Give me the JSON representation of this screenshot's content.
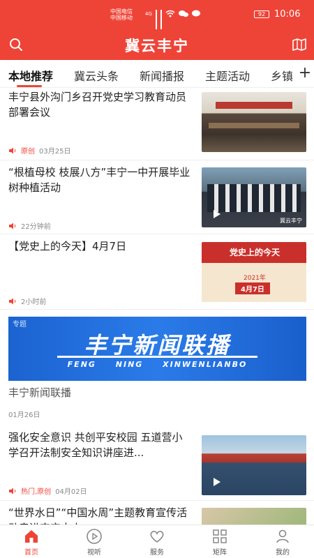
{
  "status_bar": {
    "carrier_1": "中国电信",
    "carrier_2": "中国移动",
    "network": "4G",
    "battery": "92",
    "time": "10:06"
  },
  "header": {
    "title": "冀云丰宁",
    "search_icon": "search-icon",
    "map_icon": "map-icon"
  },
  "tabs": [
    {
      "label": "本地推荐",
      "active": true
    },
    {
      "label": "冀云头条"
    },
    {
      "label": "新闻播报"
    },
    {
      "label": "主题活动"
    },
    {
      "label": "乡镇"
    }
  ],
  "tabs_more": "+",
  "news": [
    {
      "headline": "丰宁县外沟门乡召开党史学习教育动员部署会议",
      "tag": "原创",
      "time": "03月25日",
      "thumb": "meeting-photo"
    },
    {
      "headline": "“根植母校 枝展八方”丰宁一中开展毕业树种植活动",
      "tag": "",
      "time": "22分钟前",
      "thumb": "students-planting-video",
      "video_caption": "冀云丰宁"
    },
    {
      "headline": "【党史上的今天】4月7日",
      "tag": "",
      "time": "2小时前",
      "thumb": "party-history-calendar",
      "calendar_title": "党史上的今天",
      "calendar_year": "2021年",
      "calendar_day": "4月7日"
    }
  ],
  "special": {
    "badge": "专题",
    "banner_title": "丰宁新闻联播",
    "banner_pinyin": "FENG NING XINWENLIANBO",
    "title": "丰宁新闻联播",
    "date": "01月26日"
  },
  "news2": [
    {
      "headline": "强化安全意识 共创平安校园 五道营小学召开法制安全知识讲座进...",
      "tag": "热门,原创",
      "time": "04月02日",
      "thumb": "school-assembly-video"
    },
    {
      "headline": "“世界水日”“中国水周”主题教育宣传活动走进丰宁大山...",
      "thumb": "water-day-photo"
    }
  ],
  "bottom_nav": [
    {
      "label": "首页",
      "icon": "home-icon",
      "active": true
    },
    {
      "label": "视听",
      "icon": "play-circle-icon"
    },
    {
      "label": "服务",
      "icon": "heart-icon"
    },
    {
      "label": "矩阵",
      "icon": "grid-icon"
    },
    {
      "label": "我的",
      "icon": "user-icon"
    }
  ],
  "colors": {
    "brand_red": "#ee4437",
    "banner_blue": "#1b63d1"
  }
}
